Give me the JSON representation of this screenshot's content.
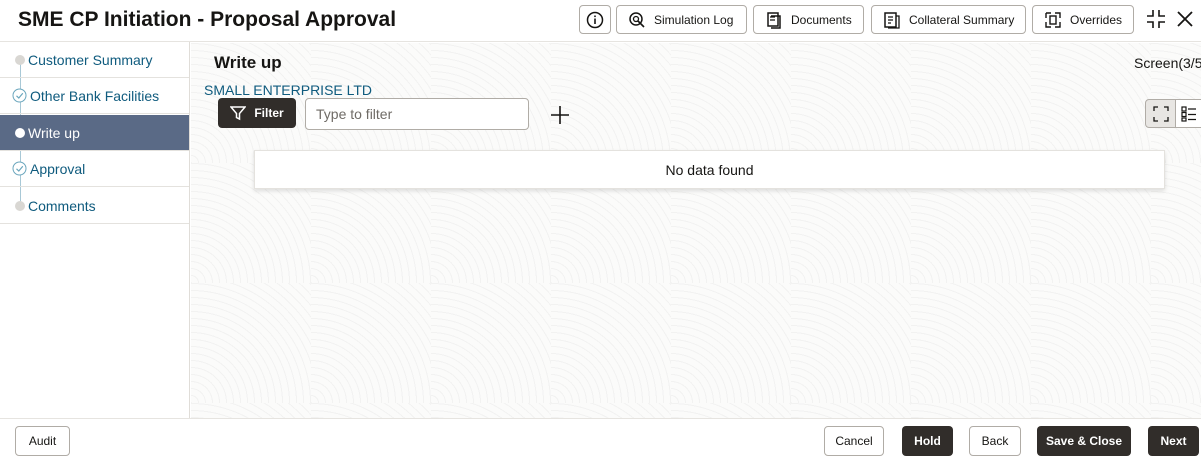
{
  "header": {
    "title": "SME CP Initiation - Proposal Approval",
    "buttons": {
      "simulation_log": "Simulation Log",
      "documents": "Documents",
      "collateral_summary": "Collateral Summary",
      "overrides": "Overrides"
    },
    "icons": [
      "info-icon",
      "simulation-icon",
      "documents-icon",
      "collateral-icon",
      "overrides-icon",
      "collapse-icon",
      "close-icon"
    ]
  },
  "sidebar": {
    "items": [
      {
        "label": "Customer Summary",
        "state": "pending"
      },
      {
        "label": "Other Bank Facilities",
        "state": "done"
      },
      {
        "label": "Write up",
        "state": "active"
      },
      {
        "label": "Approval",
        "state": "done"
      },
      {
        "label": "Comments",
        "state": "pending"
      }
    ]
  },
  "main": {
    "title": "Write up",
    "screen_count": "Screen(3/5",
    "company": "SMALL ENTERPRISE LTD",
    "filter_label": "Filter",
    "filter_placeholder": "Type to filter",
    "empty_message": "No data found"
  },
  "footer": {
    "audit": "Audit",
    "cancel": "Cancel",
    "hold": "Hold",
    "back": "Back",
    "save_close": "Save & Close",
    "next": "Next"
  },
  "colors": {
    "accent": "#0f5b7e",
    "active_nav": "#5a6a86",
    "dark_button": "#312d2a"
  }
}
